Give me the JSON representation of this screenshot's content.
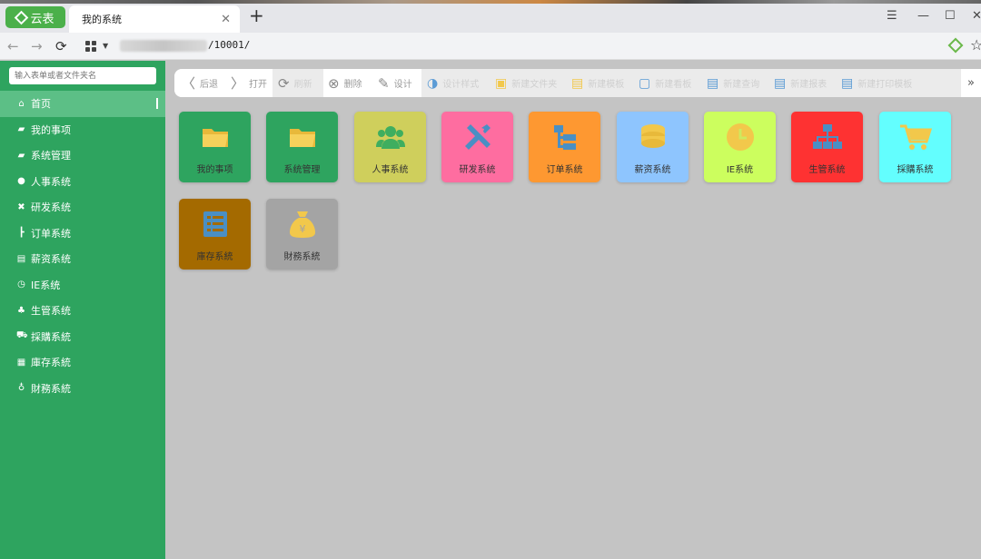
{
  "browser": {
    "app_button": "云表",
    "tab_title": "我的系统",
    "url_suffix": "/10001/"
  },
  "sidebar": {
    "search_placeholder": "输入表单或者文件夹名",
    "items": [
      {
        "label": "首页",
        "icon": "home-icon",
        "active": true
      },
      {
        "label": "我的事项",
        "icon": "folder-icon"
      },
      {
        "label": "系统管理",
        "icon": "folder-icon"
      },
      {
        "label": "人事系统",
        "icon": "users-icon"
      },
      {
        "label": "研发系统",
        "icon": "tools-icon"
      },
      {
        "label": "订单系统",
        "icon": "tree-icon"
      },
      {
        "label": "薪资系统",
        "icon": "coins-icon"
      },
      {
        "label": "IE系统",
        "icon": "clock-icon"
      },
      {
        "label": "生管系统",
        "icon": "org-chart-icon"
      },
      {
        "label": "採購系統",
        "icon": "cart-icon"
      },
      {
        "label": "庫存系統",
        "icon": "list-icon"
      },
      {
        "label": "財務系統",
        "icon": "money-bag-icon"
      }
    ]
  },
  "toolbar": {
    "back": "后退",
    "open": "打开",
    "refresh": "刷新",
    "delete": "删除",
    "design": "设计",
    "design_style": "设计样式",
    "new_folder": "新建文件夹",
    "new_template": "新建模板",
    "new_report": "新建看板",
    "new_query": "新建查询",
    "new_report2": "新建报表",
    "new_print": "新建打印模板"
  },
  "tiles": [
    {
      "label": "我的事项",
      "color": "#2ea45f",
      "icon": "folder-icon"
    },
    {
      "label": "系统管理",
      "color": "#2ea45f",
      "icon": "folder-icon"
    },
    {
      "label": "人事系统",
      "color": "#cfcf5c",
      "icon": "users-icon"
    },
    {
      "label": "研发系统",
      "color": "#fe6da0",
      "icon": "tools-icon"
    },
    {
      "label": "订单系统",
      "color": "#fe9831",
      "icon": "tree-icon"
    },
    {
      "label": "薪资系统",
      "color": "#8ec5fe",
      "icon": "coins-icon"
    },
    {
      "label": "IE系统",
      "color": "#ccfe5e",
      "icon": "clock-icon"
    },
    {
      "label": "生管系统",
      "color": "#fe3232",
      "icon": "org-chart-icon"
    },
    {
      "label": "採購系統",
      "color": "#63fefe",
      "icon": "cart-icon"
    },
    {
      "label": "庫存系統",
      "color": "#a46a00",
      "icon": "list-icon"
    },
    {
      "label": "財務系統",
      "color": "#a4a4a4",
      "icon": "money-bag-icon"
    }
  ]
}
